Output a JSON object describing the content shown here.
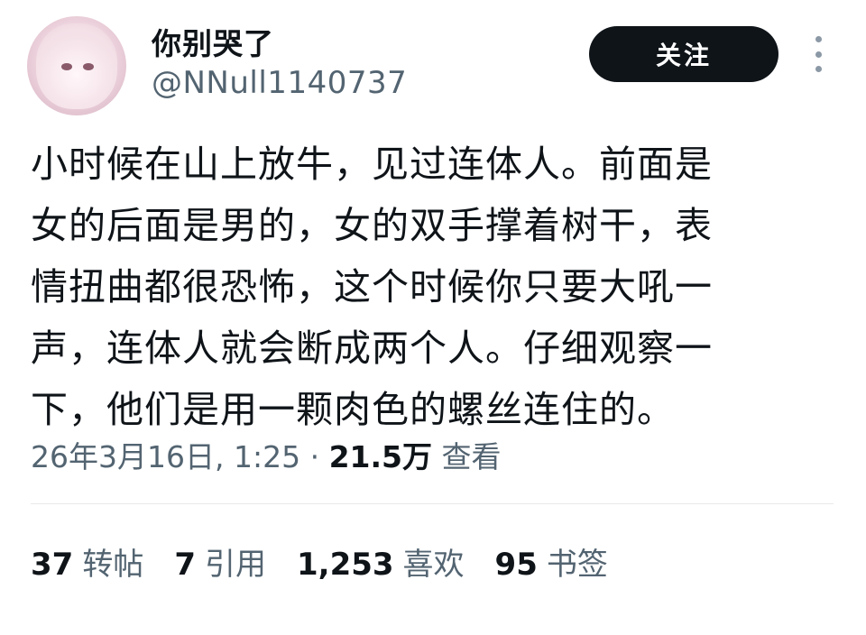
{
  "author": {
    "display_name": "你别哭了",
    "handle": "@NNull1140737",
    "avatar": "anime-avatar-image"
  },
  "follow_button": {
    "label": "关注"
  },
  "more_icon": "more-vertical-icon",
  "tweet": {
    "lines": [
      "小时候在山上放牛，见过连体人。前面是",
      "女的后面是男的，女的双手撑着树干，表",
      "情扭曲都很恐怖，这个时候你只要大吼一",
      "声，连体人就会断成两个人。仔细观察一",
      "下，他们是用一颗肉色的螺丝连住的。"
    ]
  },
  "meta": {
    "datetime": "26年3月16日, 1:25",
    "separator": "·",
    "views_count": "21.5万",
    "views_label": "查看"
  },
  "stats": [
    {
      "count": "37",
      "label": "转帖"
    },
    {
      "count": "7",
      "label": "引用"
    },
    {
      "count": "1,253",
      "label": "喜欢"
    },
    {
      "count": "95",
      "label": "书签"
    }
  ],
  "colors": {
    "text_primary": "#0f1419",
    "text_secondary": "#536471",
    "button_bg": "#0f1419",
    "divider": "#e6e9ec"
  }
}
